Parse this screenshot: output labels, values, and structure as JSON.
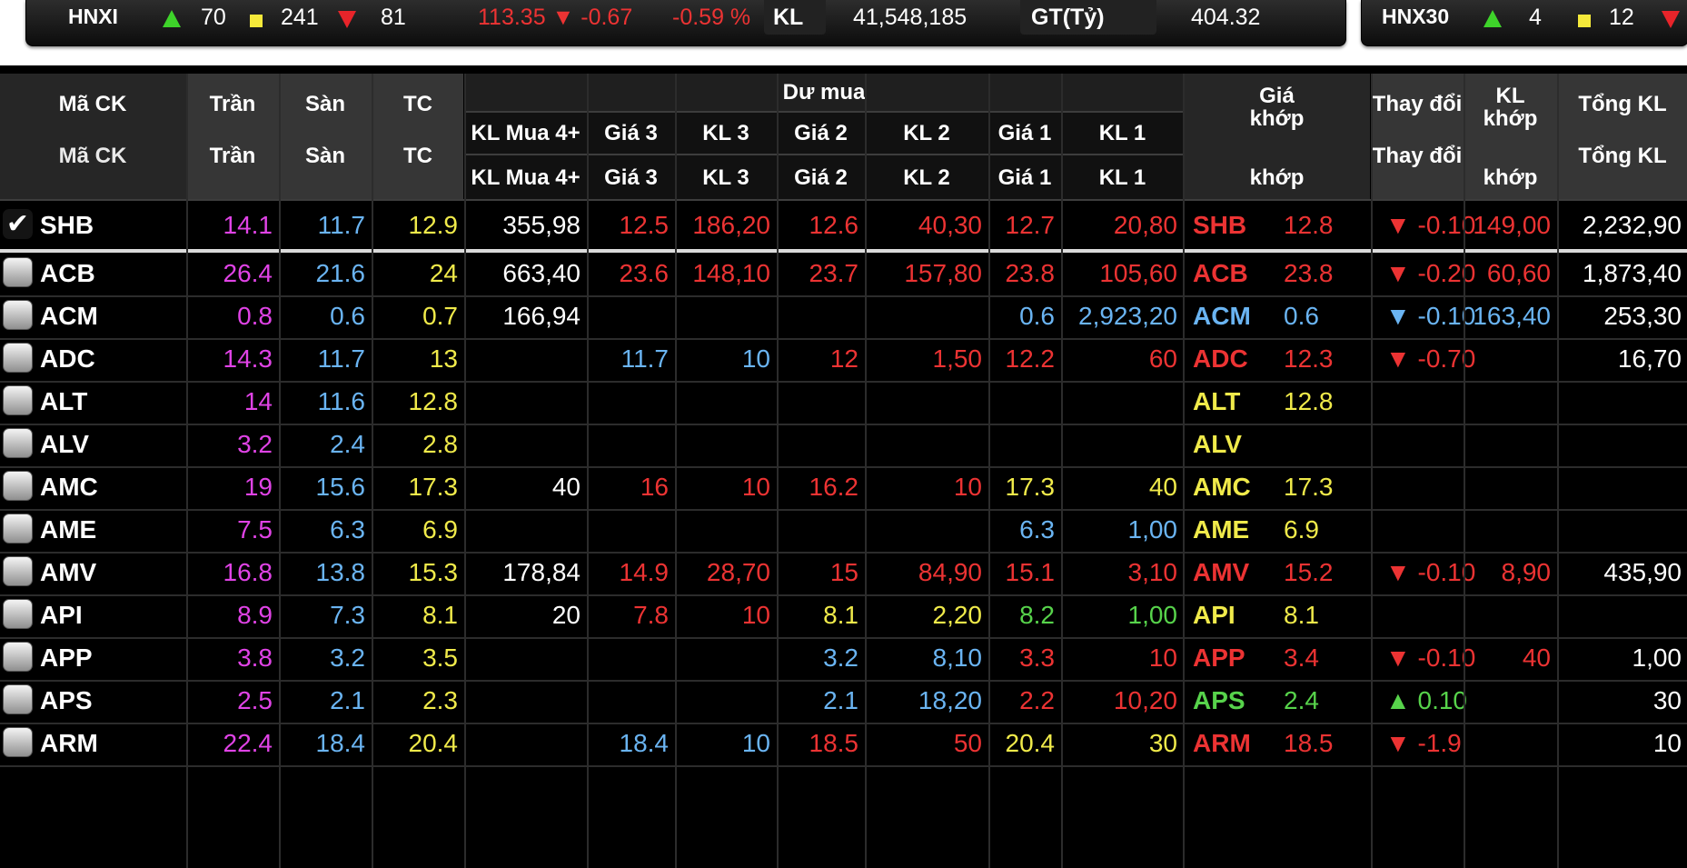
{
  "colors": {
    "ceiling": "#e043e6",
    "floor": "#6ab4f2",
    "reference": "#f0ea4a",
    "up": "#57d34b",
    "down": "#ec3333",
    "neutral": "#ffffff",
    "background": "#000000"
  },
  "ticker": {
    "index_name": "HNXI",
    "up_count": "70",
    "ref_count": "241",
    "down_count": "81",
    "change": "113.35 ▼ -0.67",
    "change_pct": "-0.59 %",
    "kl_label": "KL",
    "kl_value": "41,548,185",
    "gt_label": "GT(Tỷ)",
    "gt_value": "404.32",
    "index2_name": "HNX30",
    "index2_up": "4",
    "index2_ref": "12"
  },
  "header": {
    "symbol": "Mã CK",
    "ceiling": "Trần",
    "floor": "Sàn",
    "ref": "TC",
    "buy_group": "Dư mua",
    "kl_mua4": "KL Mua 4+",
    "gia3": "Giá 3",
    "kl3": "KL 3",
    "gia2": "Giá 2",
    "kl2": "KL 2",
    "gia1": "Giá 1",
    "kl1": "KL 1",
    "match_price": "Giá\nkhớp",
    "match_price2": "khớp",
    "change": "Thay đổi",
    "match_vol": "KL\nkhớp",
    "match_vol2": "khớp",
    "total_vol": "Tổng KL",
    "ghost_symbol": "Mã CK",
    "ghost_ceiling": "Trần",
    "ghost_floor": "Sàn",
    "ghost_ref": "TC",
    "ghost_change": "Thay đổi",
    "ghost_total": "Tổng KL"
  },
  "rows": [
    {
      "sym": "SHB",
      "checked": true,
      "ceil": "14.1",
      "floor": "11.7",
      "ref": "12.9",
      "kl4": "355,98",
      "g3": "12.5",
      "g3c": "red",
      "k3": "186,20",
      "k3c": "red",
      "g2": "12.6",
      "g2c": "red",
      "k2": "40,30",
      "k2c": "red",
      "g1": "12.7",
      "g1c": "red",
      "k1": "20,80",
      "k1c": "red",
      "msym": "SHB",
      "mp": "12.8",
      "mc": "red",
      "chg": "▼ -0.10",
      "chgc": "red",
      "mv": "149,00",
      "mvc": "red",
      "tot": "2,232,90"
    },
    {
      "sym": "ACB",
      "checked": false,
      "ceil": "26.4",
      "floor": "21.6",
      "ref": "24",
      "kl4": "663,40",
      "g3": "23.6",
      "g3c": "red",
      "k3": "148,10",
      "k3c": "red",
      "g2": "23.7",
      "g2c": "red",
      "k2": "157,80",
      "k2c": "red",
      "g1": "23.8",
      "g1c": "red",
      "k1": "105,60",
      "k1c": "red",
      "msym": "ACB",
      "mp": "23.8",
      "mc": "red",
      "chg": "▼ -0.20",
      "chgc": "red",
      "mv": "60,60",
      "mvc": "red",
      "tot": "1,873,40"
    },
    {
      "sym": "ACM",
      "checked": false,
      "ceil": "0.8",
      "floor": "0.6",
      "ref": "0.7",
      "kl4": "166,94",
      "g3": "",
      "g3c": "white",
      "k3": "",
      "k3c": "white",
      "g2": "",
      "g2c": "white",
      "k2": "",
      "k2c": "white",
      "g1": "0.6",
      "g1c": "blue",
      "k1": "2,923,20",
      "k1c": "blue",
      "msym": "ACM",
      "mp": "0.6",
      "mc": "blue",
      "chg": "▼ -0.10",
      "chgc": "blue",
      "mv": "163,40",
      "mvc": "blue",
      "tot": "253,30"
    },
    {
      "sym": "ADC",
      "checked": false,
      "ceil": "14.3",
      "floor": "11.7",
      "ref": "13",
      "kl4": "",
      "g3": "11.7",
      "g3c": "blue",
      "k3": "10",
      "k3c": "blue",
      "g2": "12",
      "g2c": "red",
      "k2": "1,50",
      "k2c": "red",
      "g1": "12.2",
      "g1c": "red",
      "k1": "60",
      "k1c": "red",
      "msym": "ADC",
      "mp": "12.3",
      "mc": "red",
      "chg": "▼ -0.70",
      "chgc": "red",
      "mv": "",
      "mvc": "red",
      "tot": "16,70"
    },
    {
      "sym": "ALT",
      "checked": false,
      "ceil": "14",
      "floor": "11.6",
      "ref": "12.8",
      "kl4": "",
      "g3": "",
      "g3c": "white",
      "k3": "",
      "k3c": "white",
      "g2": "",
      "g2c": "white",
      "k2": "",
      "k2c": "white",
      "g1": "",
      "g1c": "white",
      "k1": "",
      "k1c": "white",
      "msym": "ALT",
      "mp": "12.8",
      "mc": "yellow",
      "chg": "",
      "chgc": "white",
      "mv": "",
      "mvc": "white",
      "tot": ""
    },
    {
      "sym": "ALV",
      "checked": false,
      "ceil": "3.2",
      "floor": "2.4",
      "ref": "2.8",
      "kl4": "",
      "g3": "",
      "g3c": "white",
      "k3": "",
      "k3c": "white",
      "g2": "",
      "g2c": "white",
      "k2": "",
      "k2c": "white",
      "g1": "",
      "g1c": "white",
      "k1": "",
      "k1c": "white",
      "msym": "ALV",
      "mp": "",
      "mc": "yellow",
      "chg": "",
      "chgc": "white",
      "mv": "",
      "mvc": "white",
      "tot": ""
    },
    {
      "sym": "AMC",
      "checked": false,
      "ceil": "19",
      "floor": "15.6",
      "ref": "17.3",
      "kl4": "40",
      "g3": "16",
      "g3c": "red",
      "k3": "10",
      "k3c": "red",
      "g2": "16.2",
      "g2c": "red",
      "k2": "10",
      "k2c": "red",
      "g1": "17.3",
      "g1c": "yellow",
      "k1": "40",
      "k1c": "yellow",
      "msym": "AMC",
      "mp": "17.3",
      "mc": "yellow",
      "chg": "",
      "chgc": "white",
      "mv": "",
      "mvc": "white",
      "tot": ""
    },
    {
      "sym": "AME",
      "checked": false,
      "ceil": "7.5",
      "floor": "6.3",
      "ref": "6.9",
      "kl4": "",
      "g3": "",
      "g3c": "white",
      "k3": "",
      "k3c": "white",
      "g2": "",
      "g2c": "white",
      "k2": "",
      "k2c": "white",
      "g1": "6.3",
      "g1c": "blue",
      "k1": "1,00",
      "k1c": "blue",
      "msym": "AME",
      "mp": "6.9",
      "mc": "yellow",
      "chg": "",
      "chgc": "white",
      "mv": "",
      "mvc": "white",
      "tot": ""
    },
    {
      "sym": "AMV",
      "checked": false,
      "ceil": "16.8",
      "floor": "13.8",
      "ref": "15.3",
      "kl4": "178,84",
      "g3": "14.9",
      "g3c": "red",
      "k3": "28,70",
      "k3c": "red",
      "g2": "15",
      "g2c": "red",
      "k2": "84,90",
      "k2c": "red",
      "g1": "15.1",
      "g1c": "red",
      "k1": "3,10",
      "k1c": "red",
      "msym": "AMV",
      "mp": "15.2",
      "mc": "red",
      "chg": "▼ -0.10",
      "chgc": "red",
      "mv": "8,90",
      "mvc": "red",
      "tot": "435,90"
    },
    {
      "sym": "API",
      "checked": false,
      "ceil": "8.9",
      "floor": "7.3",
      "ref": "8.1",
      "kl4": "20",
      "g3": "7.8",
      "g3c": "red",
      "k3": "10",
      "k3c": "red",
      "g2": "8.1",
      "g2c": "yellow",
      "k2": "2,20",
      "k2c": "yellow",
      "g1": "8.2",
      "g1c": "green",
      "k1": "1,00",
      "k1c": "green",
      "msym": "API",
      "mp": "8.1",
      "mc": "yellow",
      "chg": "",
      "chgc": "white",
      "mv": "",
      "mvc": "white",
      "tot": ""
    },
    {
      "sym": "APP",
      "checked": false,
      "ceil": "3.8",
      "floor": "3.2",
      "ref": "3.5",
      "kl4": "",
      "g3": "",
      "g3c": "white",
      "k3": "",
      "k3c": "white",
      "g2": "3.2",
      "g2c": "blue",
      "k2": "8,10",
      "k2c": "blue",
      "g1": "3.3",
      "g1c": "red",
      "k1": "10",
      "k1c": "red",
      "msym": "APP",
      "mp": "3.4",
      "mc": "red",
      "chg": "▼ -0.10",
      "chgc": "red",
      "mv": "40",
      "mvc": "red",
      "tot": "1,00"
    },
    {
      "sym": "APS",
      "checked": false,
      "ceil": "2.5",
      "floor": "2.1",
      "ref": "2.3",
      "kl4": "",
      "g3": "",
      "g3c": "white",
      "k3": "",
      "k3c": "white",
      "g2": "2.1",
      "g2c": "blue",
      "k2": "18,20",
      "k2c": "blue",
      "g1": "2.2",
      "g1c": "red",
      "k1": "10,20",
      "k1c": "red",
      "msym": "APS",
      "mp": "2.4",
      "mc": "green",
      "chg": "▲ 0.10",
      "chgc": "green",
      "mv": "",
      "mvc": "green",
      "tot": "30"
    },
    {
      "sym": "ARM",
      "checked": false,
      "ceil": "22.4",
      "floor": "18.4",
      "ref": "20.4",
      "kl4": "",
      "g3": "18.4",
      "g3c": "blue",
      "k3": "10",
      "k3c": "blue",
      "g2": "18.5",
      "g2c": "red",
      "k2": "50",
      "k2c": "red",
      "g1": "20.4",
      "g1c": "yellow",
      "k1": "30",
      "k1c": "yellow",
      "msym": "ARM",
      "mp": "18.5",
      "mc": "red",
      "chg": "▼ -1.9",
      "chgc": "red",
      "mv": "",
      "mvc": "red",
      "tot": "10"
    }
  ]
}
